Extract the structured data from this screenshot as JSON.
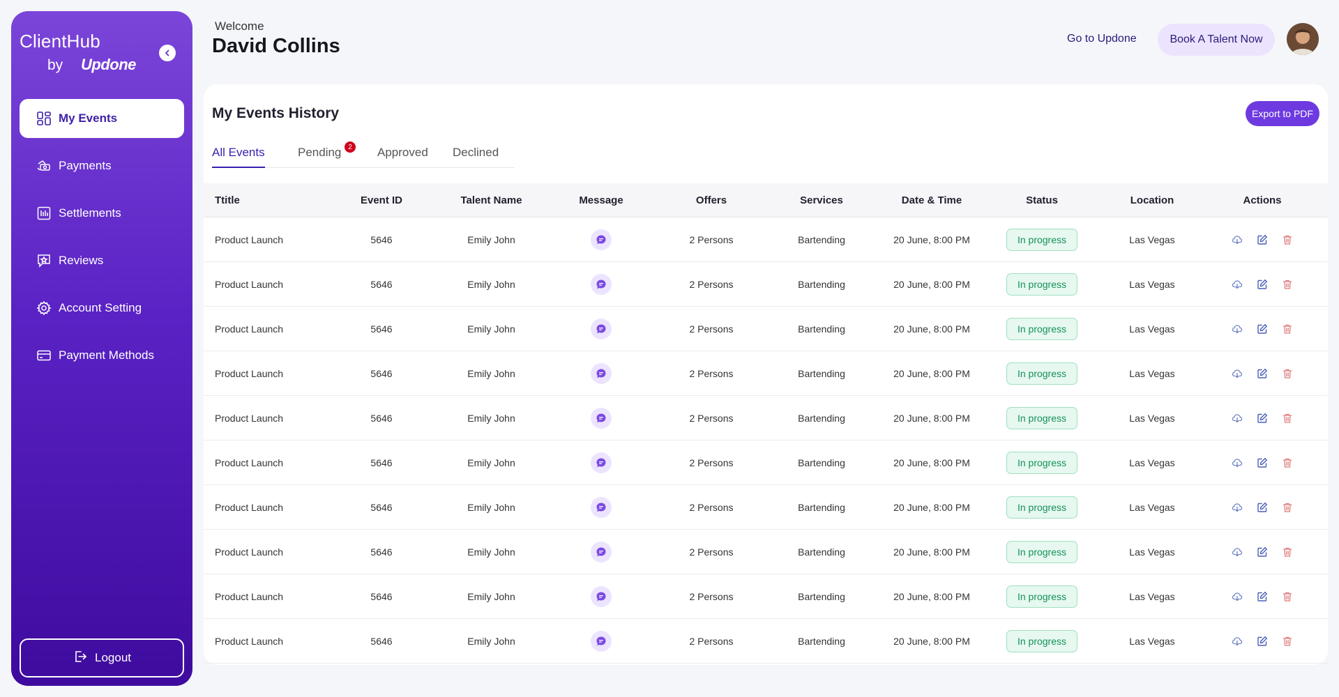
{
  "sidebar": {
    "brand_name": "ClientHub",
    "brand_by": "by",
    "brand_logo": "Updone",
    "items": [
      {
        "label": "My Events",
        "icon": "grid-icon",
        "active": true
      },
      {
        "label": "Payments",
        "icon": "cash-icon",
        "active": false
      },
      {
        "label": "Settlements",
        "icon": "ledger-icon",
        "active": false
      },
      {
        "label": "Reviews",
        "icon": "review-icon",
        "active": false
      },
      {
        "label": "Account Setting",
        "icon": "gear-icon",
        "active": false
      },
      {
        "label": "Payment Methods",
        "icon": "credit-card-icon",
        "active": false
      }
    ],
    "logout_label": "Logout"
  },
  "header": {
    "welcome": "Welcome",
    "user_name": "David Collins",
    "goto_link": "Go to Updone",
    "book_button": "Book A Talent Now"
  },
  "main": {
    "title": "My Events History",
    "export_button": "Export to PDF",
    "tabs": [
      {
        "label": "All Events",
        "active": true
      },
      {
        "label": "Pending",
        "badge": "2"
      },
      {
        "label": "Approved"
      },
      {
        "label": "Declined"
      }
    ],
    "columns": [
      "Ttitle",
      "Event ID",
      "Talent Name",
      "Message",
      "Offers",
      "Services",
      "Date & Time",
      "Status",
      "Location",
      "Actions"
    ],
    "rows": [
      {
        "title": "Product Launch",
        "event_id": "5646",
        "talent": "Emily John",
        "offers": "2 Persons",
        "services": "Bartending",
        "datetime": "20 June, 8:00 PM",
        "status": "In progress",
        "location": "Las Vegas"
      },
      {
        "title": "Product Launch",
        "event_id": "5646",
        "talent": "Emily John",
        "offers": "2 Persons",
        "services": "Bartending",
        "datetime": "20 June, 8:00 PM",
        "status": "In progress",
        "location": "Las Vegas"
      },
      {
        "title": "Product Launch",
        "event_id": "5646",
        "talent": "Emily John",
        "offers": "2 Persons",
        "services": "Bartending",
        "datetime": "20 June, 8:00 PM",
        "status": "In progress",
        "location": "Las Vegas"
      },
      {
        "title": "Product Launch",
        "event_id": "5646",
        "talent": "Emily John",
        "offers": "2 Persons",
        "services": "Bartending",
        "datetime": "20 June, 8:00 PM",
        "status": "In progress",
        "location": "Las Vegas"
      },
      {
        "title": "Product Launch",
        "event_id": "5646",
        "talent": "Emily John",
        "offers": "2 Persons",
        "services": "Bartending",
        "datetime": "20 June, 8:00 PM",
        "status": "In progress",
        "location": "Las Vegas"
      },
      {
        "title": "Product Launch",
        "event_id": "5646",
        "talent": "Emily John",
        "offers": "2 Persons",
        "services": "Bartending",
        "datetime": "20 June, 8:00 PM",
        "status": "In progress",
        "location": "Las Vegas"
      },
      {
        "title": "Product Launch",
        "event_id": "5646",
        "talent": "Emily John",
        "offers": "2 Persons",
        "services": "Bartending",
        "datetime": "20 June, 8:00 PM",
        "status": "In progress",
        "location": "Las Vegas"
      },
      {
        "title": "Product Launch",
        "event_id": "5646",
        "talent": "Emily John",
        "offers": "2 Persons",
        "services": "Bartending",
        "datetime": "20 June, 8:00 PM",
        "status": "In progress",
        "location": "Las Vegas"
      },
      {
        "title": "Product Launch",
        "event_id": "5646",
        "talent": "Emily John",
        "offers": "2 Persons",
        "services": "Bartending",
        "datetime": "20 June, 8:00 PM",
        "status": "In progress",
        "location": "Las Vegas"
      },
      {
        "title": "Product Launch",
        "event_id": "5646",
        "talent": "Emily John",
        "offers": "2 Persons",
        "services": "Bartending",
        "datetime": "20 June, 8:00 PM",
        "status": "In progress",
        "location": "Las Vegas"
      }
    ]
  },
  "colors": {
    "accent": "#6e3ae0",
    "sidebar_top": "#7b45d9",
    "sidebar_bottom": "#3e0b9e",
    "status_green": "#14915a",
    "delete_red": "#e07a7a"
  }
}
